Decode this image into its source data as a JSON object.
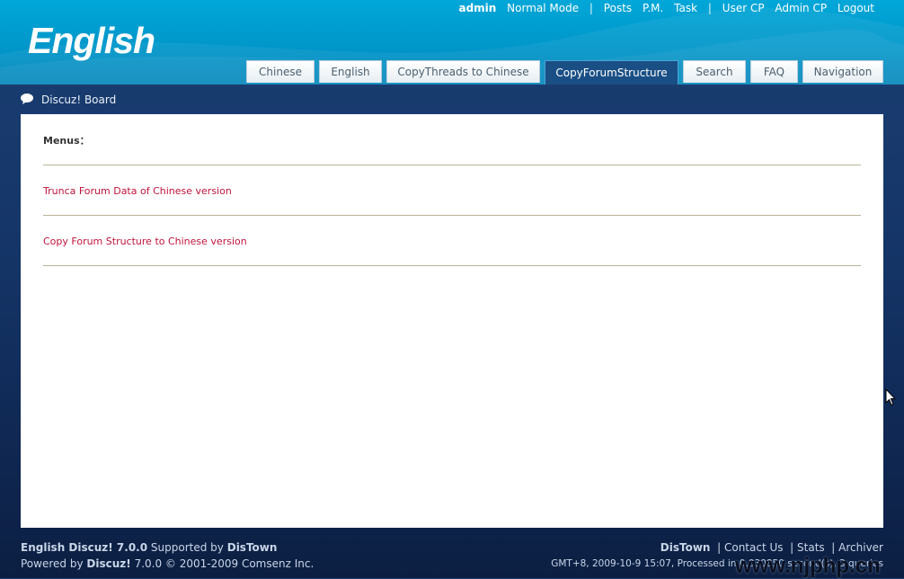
{
  "header": {
    "logo": "English",
    "user": "admin",
    "mode": "Normal Mode",
    "links": [
      "Posts",
      "P.M.",
      "Task"
    ],
    "admin_links": [
      "User CP",
      "Admin CP",
      "Logout"
    ],
    "separator": "|"
  },
  "tabs": [
    {
      "label": "Chinese",
      "active": false
    },
    {
      "label": "English",
      "active": false
    },
    {
      "label": "CopyThreads to Chinese",
      "active": false
    },
    {
      "label": "CopyForumStructure",
      "active": true
    },
    {
      "label": "Search",
      "active": false
    },
    {
      "label": "FAQ",
      "active": false
    },
    {
      "label": "Navigation",
      "active": false
    }
  ],
  "breadcrumb": {
    "label": "Discuz! Board"
  },
  "main": {
    "menus_title": "Menus：",
    "items": [
      "Trunca Forum Data of Chinese version",
      "Copy Forum Structure to Chinese version"
    ]
  },
  "footer": {
    "brand": "English Discuz! 7.0.0",
    "supported_by_text": "Supported by",
    "supported_by": "DisTown",
    "powered_text": "Powered by",
    "powered_brand": "Discuz!",
    "powered_rest": "7.0.0 © 2001-2009 Comsenz Inc.",
    "right_links": [
      "DisTown",
      "Contact Us",
      "Stats",
      "Archiver"
    ],
    "process_info": "GMT+8, 2009-10-9 15:07, Processed in 0.030850 second(s), 3 queries"
  },
  "watermark": "www.njphp.cn",
  "colors": {
    "header": "#0099cc",
    "link_red": "#c0143c",
    "active_tab": "#1a4f85"
  }
}
